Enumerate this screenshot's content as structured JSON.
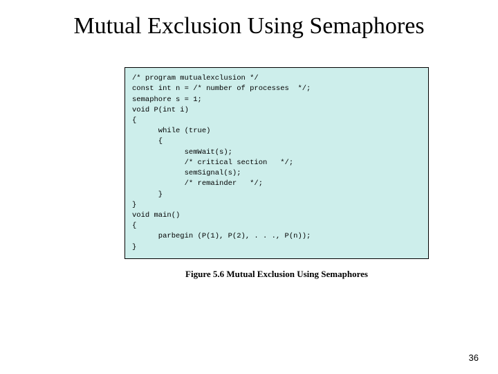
{
  "title": "Mutual Exclusion Using Semaphores",
  "code": {
    "l1": "/* program mutualexclusion */",
    "l2": "const int n = /* number of processes  */;",
    "l3": "semaphore s = 1;",
    "l4": "void P(int i)",
    "l5": "{",
    "l6": "      while (true)",
    "l7": "      {",
    "l8": "            semWait(s);",
    "l9": "            /* critical section   */;",
    "l10": "            semSignal(s);",
    "l11": "            /* remainder   */;",
    "l12": "      }",
    "l13": "}",
    "l14": "void main()",
    "l15": "{",
    "l16": "      parbegin (P(1), P(2), . . ., P(n));",
    "l17": "}"
  },
  "caption": "Figure 5.6   Mutual Exclusion Using Semaphores",
  "page_number": "36"
}
